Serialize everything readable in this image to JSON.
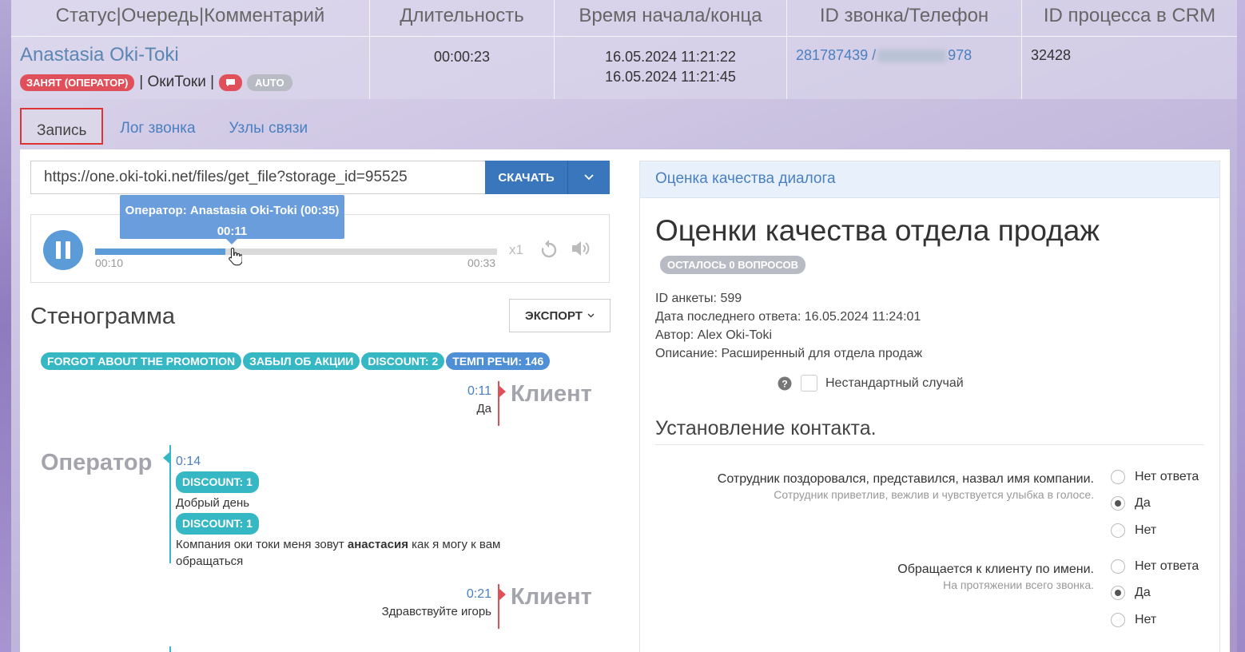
{
  "table": {
    "headers": [
      "Статус|Очередь|Комментарий",
      "Длительность",
      "Время начала/конца",
      "ID звонка/Телефон",
      "ID процесса в CRM"
    ],
    "row": {
      "operator_name": "Anastasia Oki-Toki",
      "status_badge": "ЗАНЯТ (ОПЕРАТОР)",
      "queue_text": "| ОкиТоки |",
      "auto_badge": "AUTO",
      "duration": "00:00:23",
      "start_time": "16.05.2024 11:21:22",
      "end_time": "16.05.2024 11:21:45",
      "call_id": "281787439 /",
      "phone_tail": "978",
      "crm_id": "32428"
    }
  },
  "tabs": [
    "Запись",
    "Лог звонка",
    "Узлы связи"
  ],
  "recording": {
    "url": "https://one.oki-toki.net/files/get_file?storage_id=95525",
    "download_label": "СКАЧАТЬ",
    "progress_fraction": 0.325,
    "current_time": "00:10",
    "total_time": "00:33",
    "speed": "x1",
    "tooltip_speaker": "Оператор: Anastasia Oki-Toki (00:35)",
    "tooltip_time": "00:11"
  },
  "transcript": {
    "title": "Стенограмма",
    "export_label": "ЭКСПОРТ",
    "tags": [
      {
        "label": "FORGOT ABOUT THE PROMOTION",
        "color": "#35b7c4"
      },
      {
        "label": "ЗАБЫЛ ОБ АКЦИИ",
        "color": "#35b7c4"
      },
      {
        "label": "DISCOUNT: 2",
        "color": "#35b7c4"
      },
      {
        "label": "ТЕМП РЕЧИ: 146",
        "color": "#4f8fd6"
      }
    ],
    "client_label": "Клиент",
    "operator_label": "Оператор",
    "msg1": {
      "time": "0:11",
      "text": "Да"
    },
    "msg2": {
      "time": "0:14",
      "tag1": "DISCOUNT: 1",
      "line1": "Добрый день",
      "tag2": "DISCOUNT: 1",
      "line2_a": "Компания оки токи меня зовут ",
      "line2_bold": "анастасия",
      "line2_b": " как я могу к вам обращаться"
    },
    "msg3": {
      "time": "0:21",
      "text": "Здравствуйте игорь"
    }
  },
  "quality": {
    "header": "Оценка качества диалога",
    "title": "Оценки качества отдела продаж",
    "remaining_badge": "ОСТАЛОСЬ 0 ВОПРОСОВ",
    "meta": [
      "ID анкеты: 599",
      "Дата последнего ответа: 16.05.2024 11:24:01",
      "Автор: Alex Oki-Toki",
      "Описание: Расширенный для отдела продаж"
    ],
    "nonstandard_label": "Нестандартный случай",
    "section": "Установление контакта.",
    "questions": [
      {
        "main": "Сотрудник поздоровался, представился, назвал имя компании.",
        "sub": "Сотрудник приветлив, вежлив и чувствуется улыбка в голосе.",
        "options": [
          "Нет ответа",
          "Да",
          "Нет"
        ],
        "selected": 1
      },
      {
        "main": "Обращается к клиенту по имени.",
        "sub": "На протяжении всего звонка.",
        "options": [
          "Нет ответа",
          "Да",
          "Нет"
        ],
        "selected": 1
      }
    ]
  },
  "colors": {
    "accent": "#3a76bb",
    "teal": "#35b7c4",
    "red": "#e0505b"
  }
}
